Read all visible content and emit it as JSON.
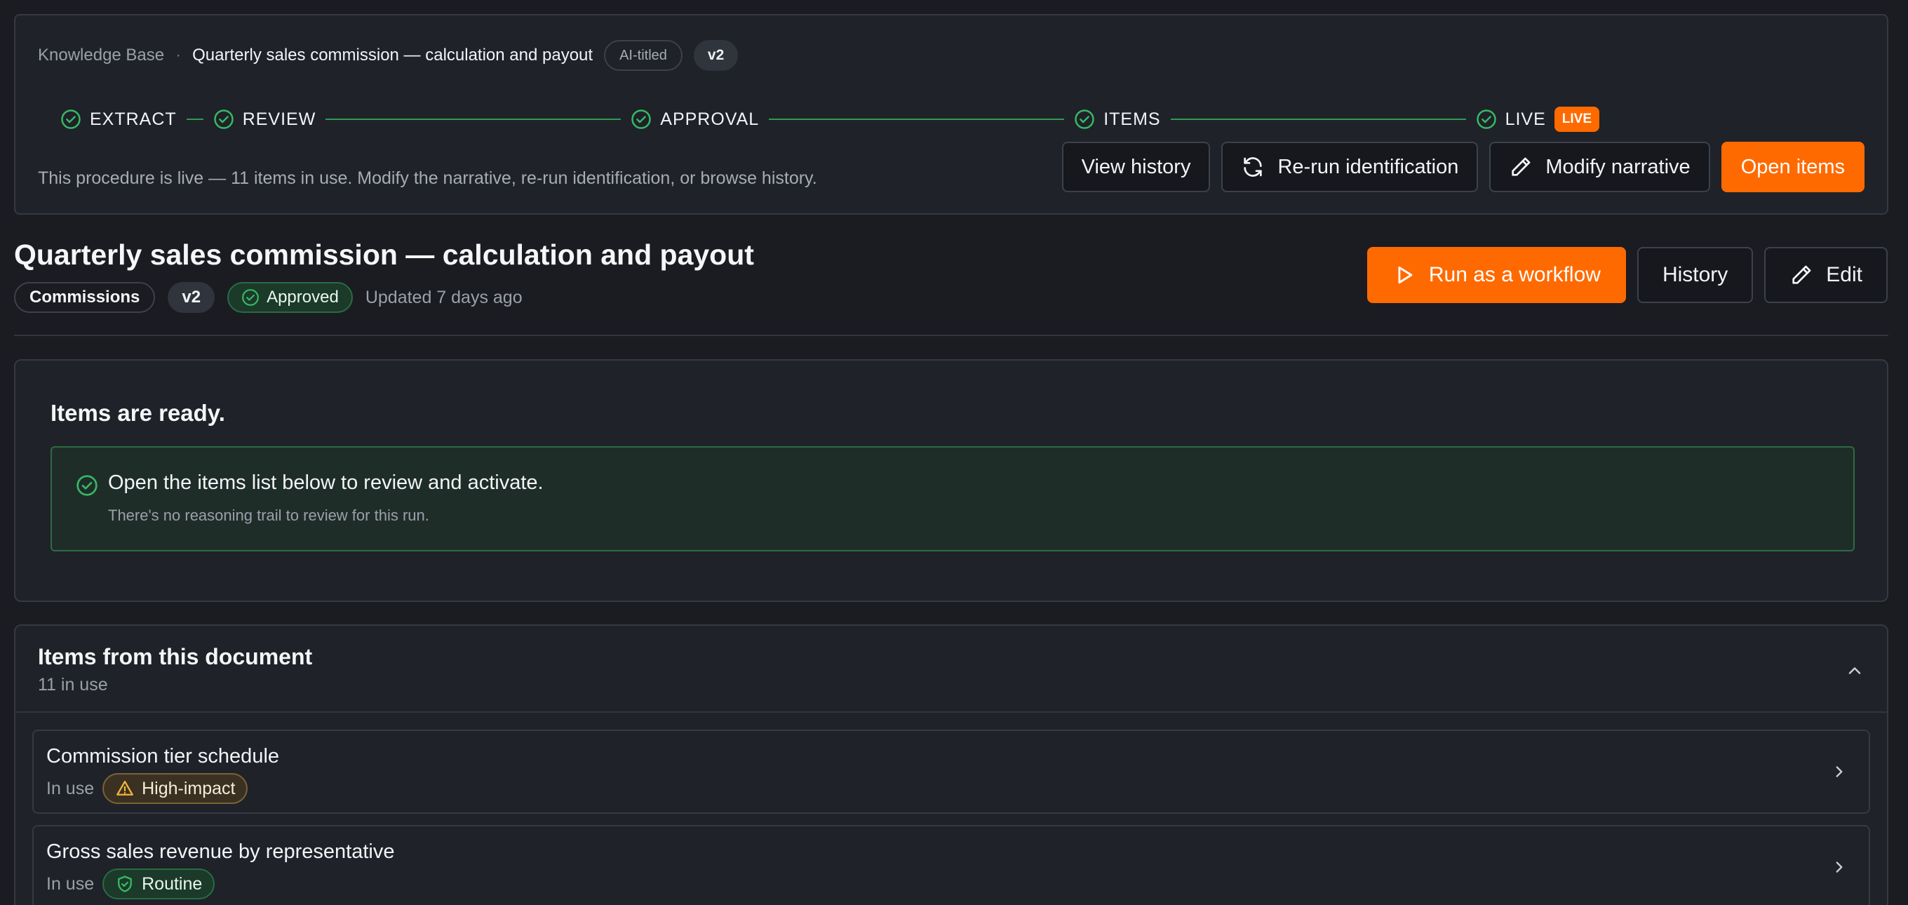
{
  "breadcrumb": {
    "root": "Knowledge Base",
    "separator": "·",
    "current": "Quarterly sales commission — calculation and payout",
    "ai_chip": "AI-titled",
    "version_chip": "v2"
  },
  "stepper": {
    "steps": [
      {
        "label": "EXTRACT"
      },
      {
        "label": "REVIEW"
      },
      {
        "label": "APPROVAL"
      },
      {
        "label": "ITEMS"
      },
      {
        "label": "LIVE"
      }
    ],
    "live_badge": "LIVE"
  },
  "status": {
    "message": "This procedure is live — 11 items in use. Modify the narrative, re-run identification, or browse history.",
    "actions": {
      "view_history": "View history",
      "rerun": "Re-run identification",
      "modify": "Modify narrative",
      "open_items": "Open items"
    }
  },
  "header": {
    "title": "Quarterly sales commission — calculation and payout",
    "tags": {
      "category": "Commissions",
      "version": "v2",
      "approval": "Approved"
    },
    "updated": "Updated 7 days ago",
    "actions": {
      "run": "Run as a workflow",
      "history": "History",
      "edit": "Edit"
    }
  },
  "ready": {
    "heading": "Items are ready.",
    "message": "Open the items list below to review and activate.",
    "sub": "There's no reasoning trail to review for this run."
  },
  "items": {
    "title": "Items from this document",
    "count": "11 in use",
    "rows": [
      {
        "name": "Commission tier schedule",
        "status": "In use",
        "impact": "High-impact"
      },
      {
        "name": "Gross sales revenue by representative",
        "status": "In use",
        "impact": "Routine"
      }
    ]
  },
  "colors": {
    "accent": "#ff6a00",
    "success": "#2e9a52",
    "warning": "#f0b43c",
    "background": "#1a1c21",
    "card": "#1f2228"
  },
  "icons": {
    "step": "check-circle-icon",
    "rerun": "refresh-icon",
    "modify": "pencil-icon",
    "run": "play-icon",
    "edit": "pencil-icon",
    "approved": "check-circle-icon",
    "collapse": "chevron-up-icon",
    "row": "chevron-right-icon",
    "high_impact": "warning-triangle-icon",
    "routine": "shield-check-icon"
  }
}
